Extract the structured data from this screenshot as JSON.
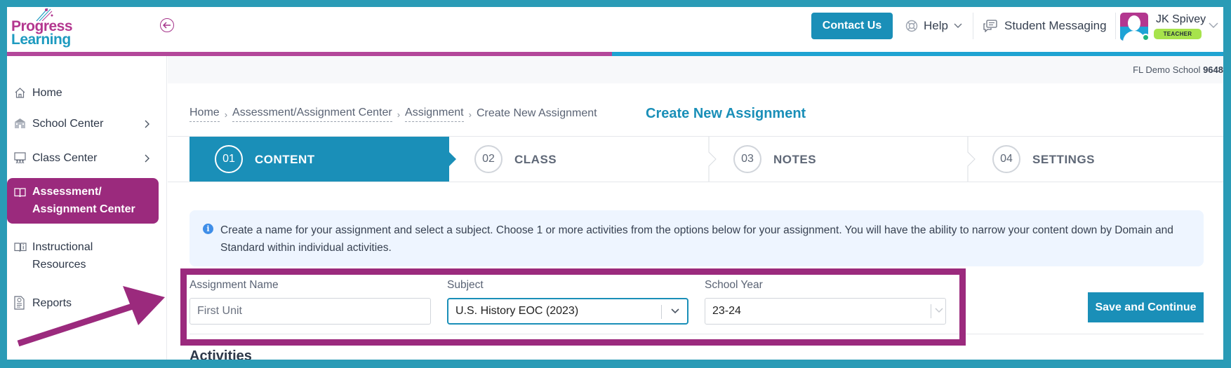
{
  "brand": {
    "logo_line1": "Progress",
    "logo_line2": "Learning",
    "colors": {
      "purple": "#b3378f",
      "teal": "#1a8fb8",
      "highlight": "#9b2a7d",
      "badge_green": "#a7e34c"
    }
  },
  "header": {
    "contact_label": "Contact Us",
    "help_label": "Help",
    "messaging_label": "Student Messaging",
    "user": {
      "name": "JK Spivey",
      "role": "TEACHER",
      "status": "online"
    },
    "icons": [
      "lifebuoy-icon",
      "chat-bubbles-icon",
      "chevron-down-icon"
    ]
  },
  "subheader": {
    "school_name": "FL Demo School",
    "school_id": "9648"
  },
  "sidebar": {
    "items": [
      {
        "label": "Home",
        "icon": "home-icon",
        "has_submenu": false,
        "active": false
      },
      {
        "label": "School Center",
        "icon": "school-icon",
        "has_submenu": true,
        "active": false
      },
      {
        "label": "Class Center",
        "icon": "classroom-icon",
        "has_submenu": true,
        "active": false
      },
      {
        "label_line1": "Assessment/",
        "label_line2": "Assignment Center",
        "icon": "book-icon",
        "has_submenu": false,
        "active": true
      },
      {
        "label_line1": "Instructional",
        "label_line2": "Resources",
        "icon": "book-info-icon",
        "has_submenu": false,
        "active": false
      },
      {
        "label": "Reports",
        "icon": "report-icon",
        "has_submenu": false,
        "active": false
      }
    ]
  },
  "breadcrumb": {
    "items": [
      "Home",
      "Assessment/Assignment Center",
      "Assignment"
    ],
    "current": "Create New Assignment"
  },
  "page_title": "Create New Assignment",
  "stepper": {
    "steps": [
      {
        "num": "01",
        "label": "CONTENT",
        "active": true
      },
      {
        "num": "02",
        "label": "CLASS",
        "active": false
      },
      {
        "num": "03",
        "label": "NOTES",
        "active": false
      },
      {
        "num": "04",
        "label": "SETTINGS",
        "active": false
      }
    ]
  },
  "info": {
    "text": "Create a name for your assignment and select a subject. Choose 1 or more activities from the options below for your assignment. You will have the ability to narrow your content down by Domain and Standard within individual activities."
  },
  "form": {
    "assignment_name": {
      "label": "Assignment Name",
      "value": "First Unit"
    },
    "subject": {
      "label": "Subject",
      "value": "U.S. History EOC (2023)"
    },
    "school_year": {
      "label": "School Year",
      "value": "23-24"
    },
    "save_label": "Save and Continue"
  },
  "activities_heading": "Activities"
}
